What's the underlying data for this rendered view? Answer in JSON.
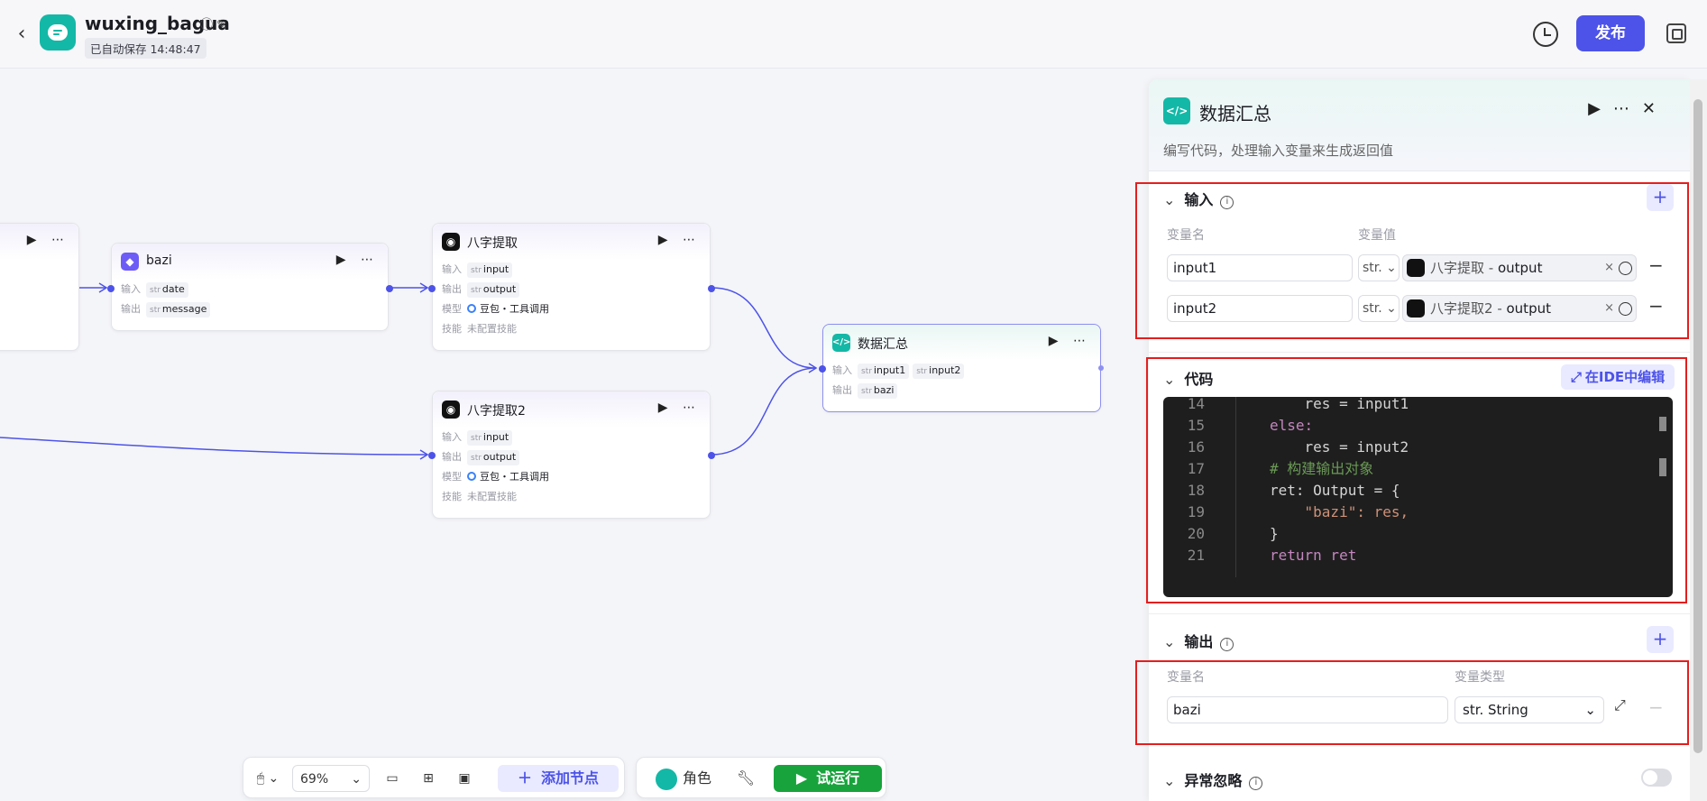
{
  "header": {
    "title": "wuxing_bagua",
    "autosave": "已自动保存 14:48:47",
    "publish_label": "发布",
    "back_icon": "chevron-left-icon"
  },
  "canvas": {
    "nodes": {
      "first": {
        "title": ""
      },
      "bazi": {
        "title": "bazi",
        "in_label": "输入",
        "out_label": "输出",
        "input_type": "str",
        "input": "date",
        "output_type": "str",
        "output": "message"
      },
      "extract1": {
        "title": "八字提取",
        "in_label": "输入",
        "out_label": "输出",
        "model_label": "模型",
        "skill_label": "技能",
        "input_type": "str",
        "input": "input",
        "output_type": "str",
        "output": "output",
        "model": "豆包・工具调用",
        "skill": "未配置技能"
      },
      "extract2": {
        "title": "八字提取2",
        "in_label": "输入",
        "out_label": "输出",
        "model_label": "模型",
        "skill_label": "技能",
        "input_type": "str",
        "input": "input",
        "output_type": "str",
        "output": "output",
        "model": "豆包・工具调用",
        "skill": "未配置技能"
      },
      "summary": {
        "title": "数据汇总",
        "in_label": "输入",
        "out_label": "输出",
        "input1_type": "str",
        "input1": "input1",
        "input2_type": "str",
        "input2": "input2",
        "output_type": "str",
        "output": "bazi"
      }
    }
  },
  "toolbar": {
    "zoom": "69%",
    "add_node": "添加节点",
    "role": "角色",
    "run": "试运行"
  },
  "panel": {
    "title": "数据汇总",
    "description": "编写代码，处理输入变量来生成返回值",
    "input_section": {
      "title": "输入",
      "col_name": "变量名",
      "col_value": "变量值",
      "rows": [
        {
          "name": "input1",
          "type": "str.",
          "ref_node": "八字提取",
          "ref_sep": " - ",
          "ref_var": "output"
        },
        {
          "name": "input2",
          "type": "str.",
          "ref_node": "八字提取2",
          "ref_sep": " - ",
          "ref_var": "output"
        }
      ]
    },
    "code_section": {
      "title": "代码",
      "ide_button": "在IDE中编辑",
      "lines": [
        {
          "n": "14",
          "text": "    res = input1"
        },
        {
          "n": "15",
          "text": "else:"
        },
        {
          "n": "16",
          "text": "    res = input2"
        },
        {
          "n": "17",
          "text": "# 构建输出对象"
        },
        {
          "n": "18",
          "text": "ret: Output = {"
        },
        {
          "n": "19",
          "text": "    \"bazi\": res,"
        },
        {
          "n": "20",
          "text": "}"
        },
        {
          "n": "21",
          "text": "return ret"
        }
      ]
    },
    "output_section": {
      "title": "输出",
      "col_name": "变量名",
      "col_type": "变量类型",
      "rows": [
        {
          "name": "bazi",
          "type": "str. String"
        }
      ]
    },
    "exception_section": {
      "title": "异常忽略",
      "enabled": false
    }
  },
  "colors": {
    "accent": "#4d53e8",
    "teal": "#14b8a6",
    "run_green": "#18a33c",
    "highlight_red": "#e41e1e"
  }
}
